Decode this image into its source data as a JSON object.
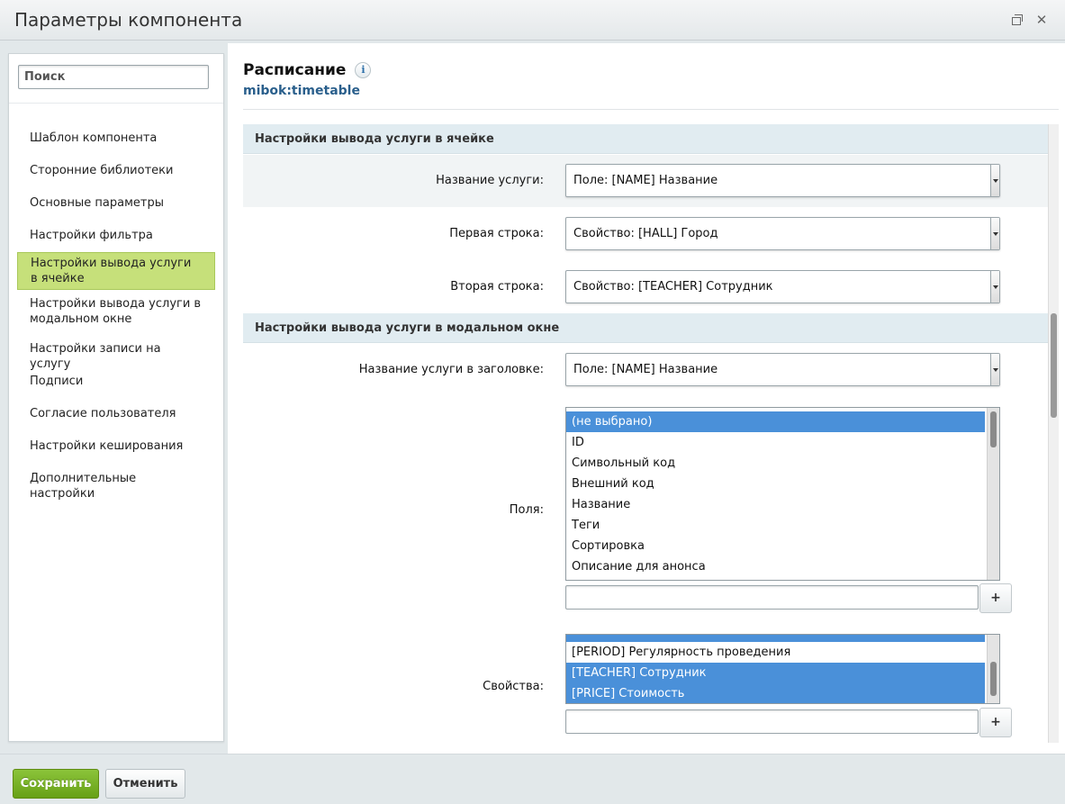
{
  "window": {
    "title": "Параметры компонента",
    "restore_icon": "restore-icon",
    "close_glyph": "✕"
  },
  "sidebar": {
    "search_placeholder": "Поиск",
    "items": [
      {
        "label": "Шаблон компонента"
      },
      {
        "label": "Сторонние библиотеки"
      },
      {
        "label": "Основные параметры"
      },
      {
        "label": "Настройки фильтра"
      },
      {
        "label": "Настройки вывода услуги в ячейке",
        "active": true
      },
      {
        "label": "Настройки вывода услуги в модальном окне"
      },
      {
        "label": "Настройки записи на услугу"
      },
      {
        "label": "Подписи"
      },
      {
        "label": "Согласие пользователя"
      },
      {
        "label": "Настройки кеширования"
      },
      {
        "label": "Дополнительные настройки"
      }
    ]
  },
  "component": {
    "title": "Расписание",
    "code": "mibok:timetable",
    "info_glyph": "i"
  },
  "sections": {
    "cell": {
      "title": "Настройки вывода услуги в ячейке",
      "fields": [
        {
          "label": "Название услуги:",
          "value": "Поле: [NAME] Название"
        },
        {
          "label": "Первая строка:",
          "value": "Свойство: [HALL] Город"
        },
        {
          "label": "Вторая строка:",
          "value": "Свойство: [TEACHER] Сотрудник"
        }
      ]
    },
    "modal": {
      "title": "Настройки вывода услуги в модальном окне",
      "header_field": {
        "label": "Название услуги в заголовке:",
        "value": "Поле: [NAME] Название"
      },
      "fields_list": {
        "label": "Поля:",
        "items": [
          {
            "text": "(не выбрано)",
            "selected": true
          },
          {
            "text": "ID",
            "selected": false
          },
          {
            "text": "Символьный код",
            "selected": false
          },
          {
            "text": "Внешний код",
            "selected": false
          },
          {
            "text": "Название",
            "selected": false
          },
          {
            "text": "Теги",
            "selected": false
          },
          {
            "text": "Сортировка",
            "selected": false
          },
          {
            "text": "Описание для анонса",
            "selected": false
          }
        ]
      },
      "props_list": {
        "label": "Свойства:",
        "items": [
          {
            "text": "[PERIOD] Регулярность проведения",
            "selected": false
          },
          {
            "text": "[TEACHER] Сотрудник",
            "selected": true
          },
          {
            "text": "[PRICE] Стоимость",
            "selected": true
          }
        ]
      },
      "add_label": "+"
    }
  },
  "footer": {
    "save_label": "Сохранить",
    "cancel_label": "Отменить"
  },
  "colors": {
    "accent_green": "#67a016",
    "active_nav": "#c6e07a",
    "selection_blue": "#4a90d9",
    "section_bg": "#e1ecf1"
  }
}
